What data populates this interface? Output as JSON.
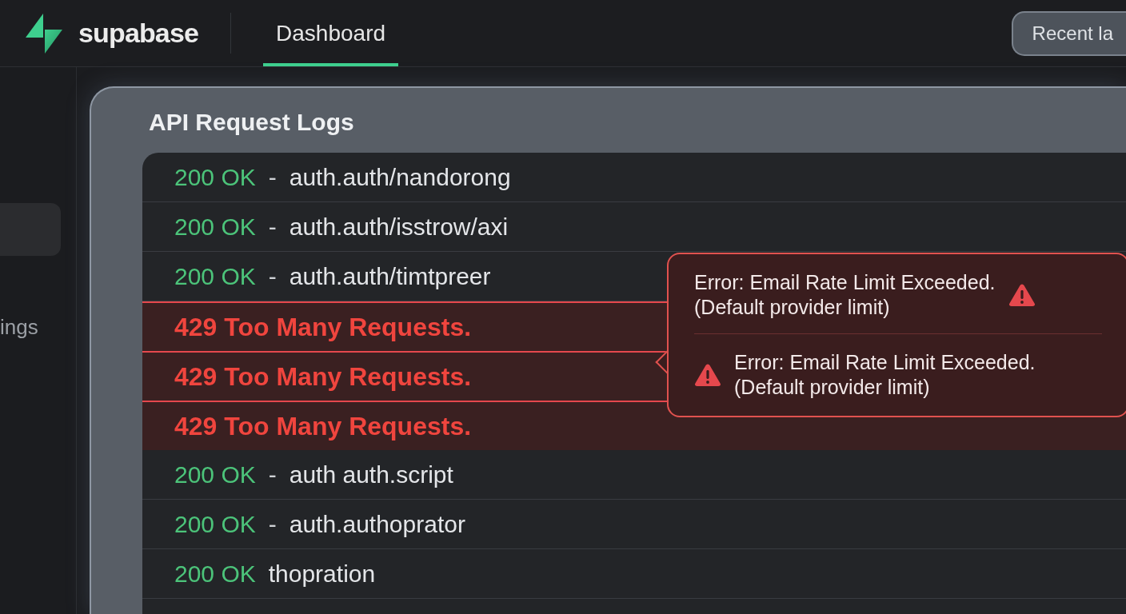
{
  "header": {
    "logo_text": "supabase",
    "tabs": [
      {
        "label": "Dashboard",
        "selected": true
      }
    ],
    "recent_button": "Recent la"
  },
  "sidebar": {
    "items": [
      {
        "selected": true
      },
      {
        "label": "ings",
        "selected": false
      }
    ]
  },
  "panel": {
    "title": "API Request Logs",
    "rows": [
      {
        "kind": "ok",
        "status": "200 OK",
        "separator": "-",
        "path": "auth.auth/nandorong"
      },
      {
        "kind": "ok",
        "status": "200 OK",
        "separator": "-",
        "path": "auth.auth/isstrow/axi"
      },
      {
        "kind": "ok",
        "status": "200 OK",
        "separator": "-",
        "path": "auth.auth/timtpreer"
      },
      {
        "kind": "error",
        "status": "429 Too Many Requests."
      },
      {
        "kind": "error",
        "status": "429 Too Many Requests."
      },
      {
        "kind": "error",
        "status": "429 Too Many Requests."
      },
      {
        "kind": "ok",
        "status": "200 OK",
        "separator": "-",
        "path": "auth auth.script"
      },
      {
        "kind": "ok",
        "status": "200 OK",
        "separator": "-",
        "path": "auth.authoprator"
      },
      {
        "kind": "ok",
        "status": "200 OK",
        "path": "thopration"
      }
    ]
  },
  "popover": {
    "messages": [
      {
        "kind": "trailing",
        "text": "Error: Email Rate Limit Exceeded.",
        "detail": "(Default provider limit)"
      },
      {
        "kind": "leading",
        "text": "Error: Email Rate Limit Exceeded.",
        "detail": "(Default provider limit)"
      }
    ]
  }
}
